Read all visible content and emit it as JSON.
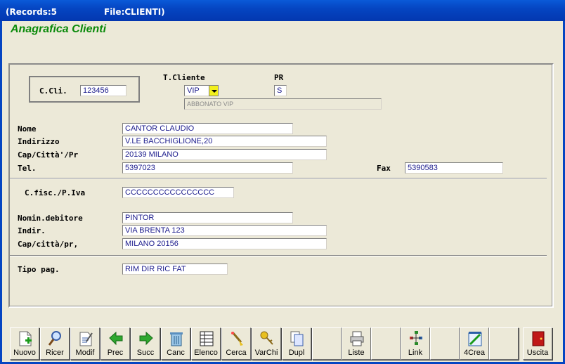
{
  "titlebar": {
    "records": "(Records:5",
    "file": "File:CLIENTI)"
  },
  "form": {
    "title": "Anagrafica Clienti"
  },
  "labels": {
    "ccli": "C.Cli.",
    "tcliente": "T.Cliente",
    "pr": "PR",
    "nome": "Nome",
    "indirizzo": "Indirizzo",
    "cap": "Cap/Città'/Pr",
    "tel": "Tel.",
    "fax": "Fax",
    "cfisc": "C.fisc./P.Iva",
    "nomin": "Nomin.debitore",
    "indir": "Indir.",
    "cap2": "Cap/città/pr,",
    "tipopag": "Tipo pag."
  },
  "values": {
    "ccli": "123456",
    "tcliente": "VIP",
    "pr": "S",
    "tcliente_desc": "ABBONATO VIP",
    "nome": "CANTOR CLAUDIO",
    "indirizzo": "V.LE BACCHIGLIONE,20",
    "cap": "20139 MILANO",
    "tel": "5397023",
    "fax": "5390583",
    "cfisc": "CCCCCCCCCCCCCCCC",
    "nomin": "PINTOR",
    "indir": "VIA BRENTA 123",
    "cap2": "MILANO  20156",
    "tipopag": "RIM DIR RIC FAT"
  },
  "toolbar": [
    {
      "label": "Nuovo",
      "icon": "new-document-icon"
    },
    {
      "label": "Ricer",
      "icon": "magnifier-icon"
    },
    {
      "label": "Modif",
      "icon": "edit-document-icon"
    },
    {
      "label": "Prec",
      "icon": "arrow-left-icon"
    },
    {
      "label": "Succ",
      "icon": "arrow-right-icon"
    },
    {
      "label": "Canc",
      "icon": "trash-icon"
    },
    {
      "label": "Elenco",
      "icon": "table-list-icon"
    },
    {
      "label": "Cerca",
      "icon": "search-sparkle-icon"
    },
    {
      "label": "VarChi",
      "icon": "keys-icon"
    },
    {
      "label": "Dupl",
      "icon": "duplicate-icon"
    },
    {
      "label": "",
      "icon": ""
    },
    {
      "label": "Liste",
      "icon": "printer-icon"
    },
    {
      "label": "",
      "icon": ""
    },
    {
      "label": "Link",
      "icon": "link-tree-icon"
    },
    {
      "label": "",
      "icon": ""
    },
    {
      "label": "4Crea",
      "icon": "create-tool-icon"
    },
    {
      "label": "",
      "icon": ""
    },
    {
      "label": "Uscita",
      "icon": "exit-door-icon"
    }
  ]
}
